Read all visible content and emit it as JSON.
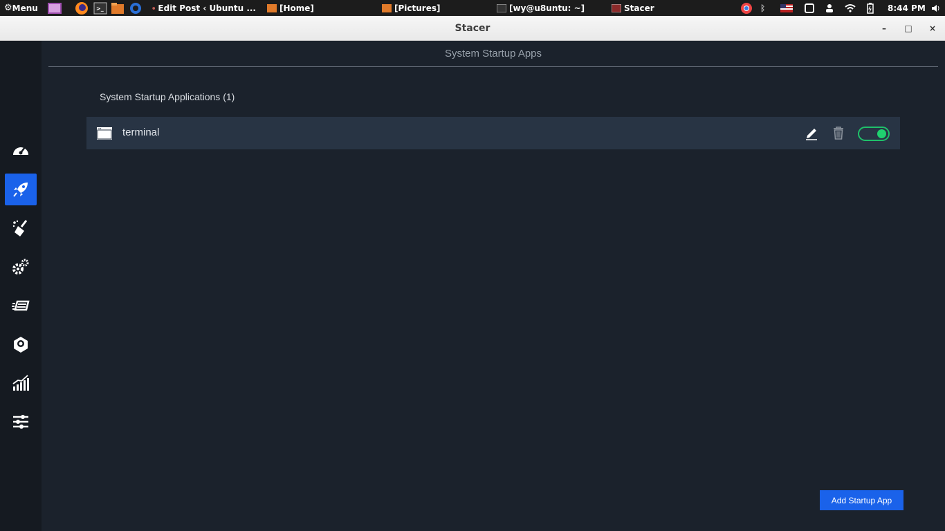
{
  "system_panel": {
    "menu_label": "Menu",
    "tasks": [
      {
        "label": "Edit Post ‹ Ubuntu ...",
        "icon": "chrome-icon"
      },
      {
        "label": "[Home]",
        "icon": "folder-icon"
      },
      {
        "label": "[Pictures]",
        "icon": "folder-icon"
      },
      {
        "label": "[wy@u8untu: ~]",
        "icon": "terminal-icon"
      },
      {
        "label": "Stacer",
        "icon": "stacer-icon"
      }
    ],
    "clock": "8:44 PM"
  },
  "window": {
    "title": "Stacer",
    "minimize": "–",
    "maximize": "□",
    "close": "×"
  },
  "sidebar": {
    "items": [
      {
        "name": "dashboard",
        "icon": "speedometer-icon"
      },
      {
        "name": "startup-apps",
        "icon": "rocket-icon",
        "active": true
      },
      {
        "name": "system-cleaner",
        "icon": "broom-icon"
      },
      {
        "name": "services",
        "icon": "gears-icon"
      },
      {
        "name": "processes",
        "icon": "processes-icon"
      },
      {
        "name": "uninstaller",
        "icon": "package-icon"
      },
      {
        "name": "resources",
        "icon": "chart-icon"
      },
      {
        "name": "settings",
        "icon": "sliders-icon"
      }
    ]
  },
  "main": {
    "page_title": "System Startup Apps",
    "section_title": "System Startup Applications (1)",
    "apps": [
      {
        "name": "terminal",
        "enabled": true
      }
    ],
    "add_button": "Add Startup App"
  },
  "colors": {
    "accent": "#1a62ea",
    "toggle_on": "#1fc06a",
    "background": "#1b222c",
    "sidebar": "#151a21",
    "row": "#283444"
  }
}
